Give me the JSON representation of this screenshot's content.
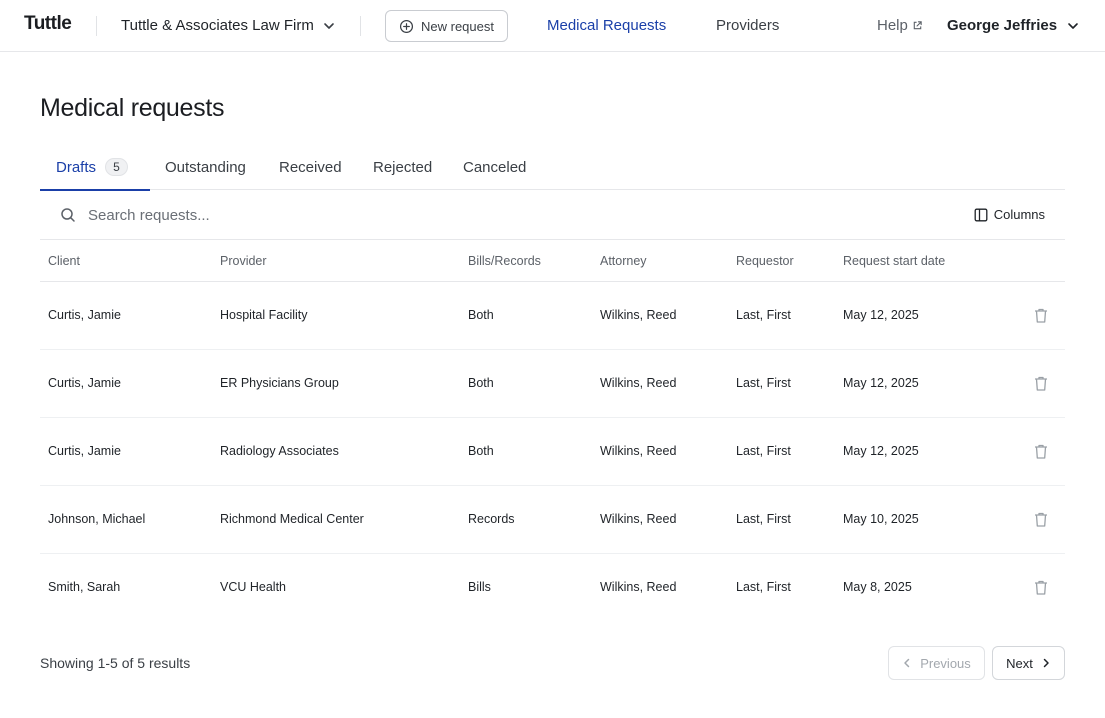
{
  "header": {
    "logo": "Tuttle",
    "firm": "Tuttle & Associates Law Firm",
    "new_request": "New request",
    "nav": [
      "Medical Requests",
      "Providers"
    ],
    "help": "Help",
    "user": "George Jeffries"
  },
  "page": {
    "title": "Medical requests"
  },
  "tabs": [
    {
      "label": "Drafts",
      "count": "5"
    },
    {
      "label": "Outstanding"
    },
    {
      "label": "Received"
    },
    {
      "label": "Rejected"
    },
    {
      "label": "Canceled"
    }
  ],
  "search": {
    "placeholder": "Search requests..."
  },
  "toolbar": {
    "columns": "Columns"
  },
  "table": {
    "headers": [
      "Client",
      "Provider",
      "Bills/Records",
      "Attorney",
      "Requestor",
      "Request start date"
    ],
    "rows": [
      [
        "Curtis, Jamie",
        "Hospital Facility",
        "Both",
        "Wilkins, Reed",
        "Last, First",
        "May 12, 2025"
      ],
      [
        "Curtis, Jamie",
        "ER Physicians Group",
        "Both",
        "Wilkins, Reed",
        "Last, First",
        "May 12, 2025"
      ],
      [
        "Curtis, Jamie",
        "Radiology Associates",
        "Both",
        "Wilkins, Reed",
        "Last, First",
        "May 12, 2025"
      ],
      [
        "Johnson, Michael",
        "Richmond Medical Center",
        "Records",
        "Wilkins, Reed",
        "Last, First",
        "May 10, 2025"
      ],
      [
        "Smith, Sarah",
        "VCU Health",
        "Bills",
        "Wilkins, Reed",
        "Last, First",
        "May 8, 2025"
      ]
    ]
  },
  "footer": {
    "showing": "Showing 1-5 of 5 results",
    "previous": "Previous",
    "next": "Next"
  },
  "icons": {
    "chevron": "chevron-down-icon",
    "plus": "plus-circle-icon",
    "external": "external-link-icon",
    "search": "search-icon",
    "columns": "columns-icon",
    "trash": "trash-icon"
  },
  "colors": {
    "accent": "#1a3fa8",
    "border": "#e6e7ea",
    "muted": "#5c6168"
  }
}
